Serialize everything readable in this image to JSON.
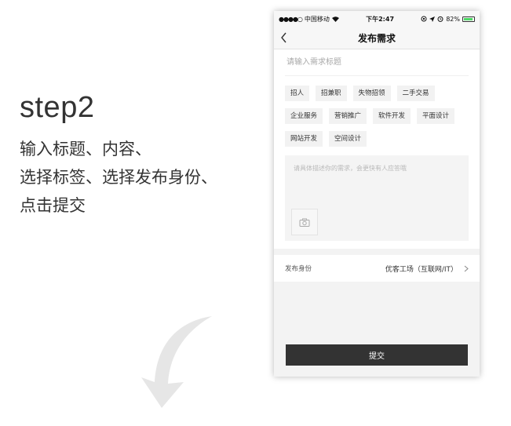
{
  "step": {
    "title": "step2",
    "lines": [
      "输入标题、内容、",
      "选择标签、选择发布身份、",
      "点击提交"
    ]
  },
  "status_bar": {
    "signal": "●●●●○",
    "carrier": "中国移动",
    "time": "下午2:47",
    "battery": "82%",
    "battery_level": 0.82
  },
  "nav": {
    "title": "发布需求"
  },
  "form": {
    "title_placeholder": "请输入需求标题",
    "tags": [
      "招人",
      "招兼职",
      "失物招领",
      "二手交易",
      "企业服务",
      "营销推广",
      "软件开发",
      "平面设计",
      "网站开发",
      "空间设计"
    ],
    "desc_placeholder": "请具体描述你的需求，会更快有人应答哦",
    "identity_label": "发布身份",
    "identity_value": "优客工场（互联网/IT）",
    "submit_label": "提交"
  },
  "colors": {
    "battery": "#4cd964",
    "submit_bg": "#333333"
  }
}
